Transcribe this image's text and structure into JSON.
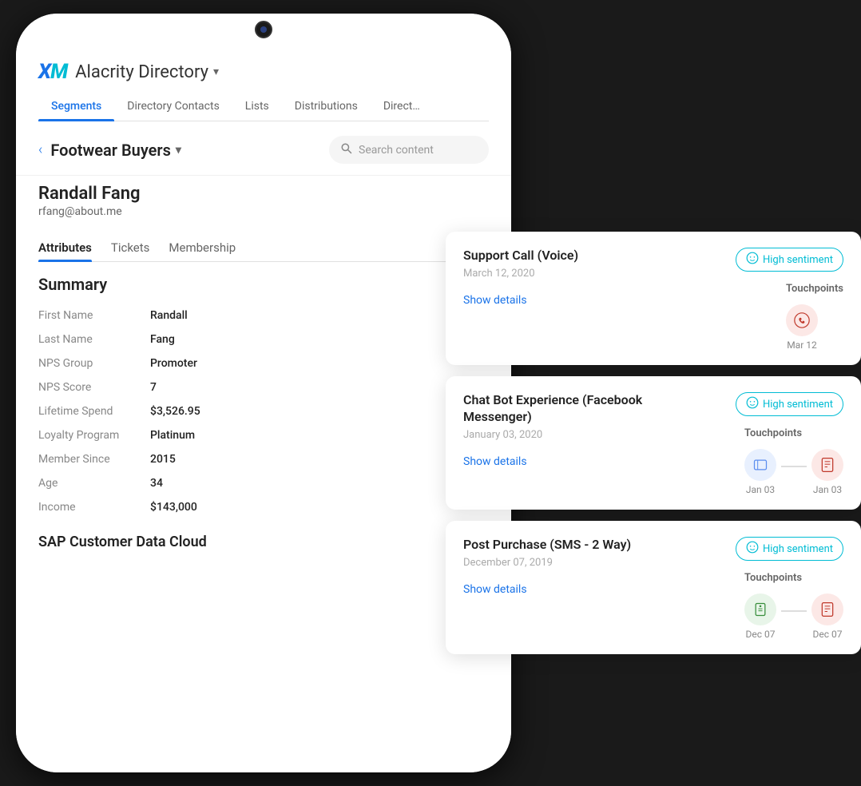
{
  "app": {
    "logo_x": "X",
    "logo_m": "M",
    "directory_title": "Alacrity Directory",
    "chevron": "▾"
  },
  "nav": {
    "tabs": [
      {
        "label": "Segments",
        "active": true
      },
      {
        "label": "Directory Contacts",
        "active": false
      },
      {
        "label": "Lists",
        "active": false
      },
      {
        "label": "Distributions",
        "active": false
      },
      {
        "label": "Direct…",
        "active": false
      }
    ]
  },
  "breadcrumb": {
    "back": "‹",
    "segment_name": "Footwear Buyers",
    "chevron": "▾",
    "search_placeholder": "Search content"
  },
  "contact": {
    "name": "Randall Fang",
    "email": "rfang@about.me",
    "sub_tabs": [
      "Attributes",
      "Tickets",
      "Membership"
    ],
    "active_sub_tab": "Attributes"
  },
  "summary": {
    "title": "Summary",
    "attributes": [
      {
        "label": "First Name",
        "value": "Randall"
      },
      {
        "label": "Last Name",
        "value": "Fang"
      },
      {
        "label": "NPS Group",
        "value": "Promoter"
      },
      {
        "label": "NPS Score",
        "value": "7"
      },
      {
        "label": "Lifetime Spend",
        "value": "$3,526.95"
      },
      {
        "label": "Loyalty Program",
        "value": "Platinum"
      },
      {
        "label": "Member Since",
        "value": "2015"
      },
      {
        "label": "Age",
        "value": "34"
      },
      {
        "label": "Income",
        "value": "$143,000"
      }
    ],
    "footer_section": "SAP Customer Data Cloud"
  },
  "journey_cards": [
    {
      "title": "Support Call (Voice)",
      "date": "March 12, 2020",
      "show_details": "Show details",
      "touchpoints_label": "Touchpoints",
      "sentiment": "High sentiment",
      "touchpoints": [
        {
          "icon": "☎",
          "date": "Mar 12",
          "bg": "pink"
        }
      ]
    },
    {
      "title": "Chat Bot Experience (Facebook Messenger)",
      "date": "January 03, 2020",
      "show_details": "Show details",
      "touchpoints_label": "Touchpoints",
      "sentiment": "High sentiment",
      "touchpoints": [
        {
          "icon": "⊡",
          "date": "Jan 03",
          "bg": "blue"
        },
        {
          "icon": "📋",
          "date": "Jan 03",
          "bg": "pink"
        }
      ]
    },
    {
      "title": "Post Purchase (SMS - 2 Way)",
      "date": "December 07, 2019",
      "show_details": "Show details",
      "touchpoints_label": "Touchpoints",
      "sentiment": "High sentiment",
      "touchpoints": [
        {
          "icon": "📱",
          "date": "Dec 07",
          "bg": "green"
        },
        {
          "icon": "📋",
          "date": "Dec 07",
          "bg": "pink"
        }
      ]
    }
  ],
  "icons": {
    "search": "🔍",
    "sentiment_smile": "☺"
  }
}
